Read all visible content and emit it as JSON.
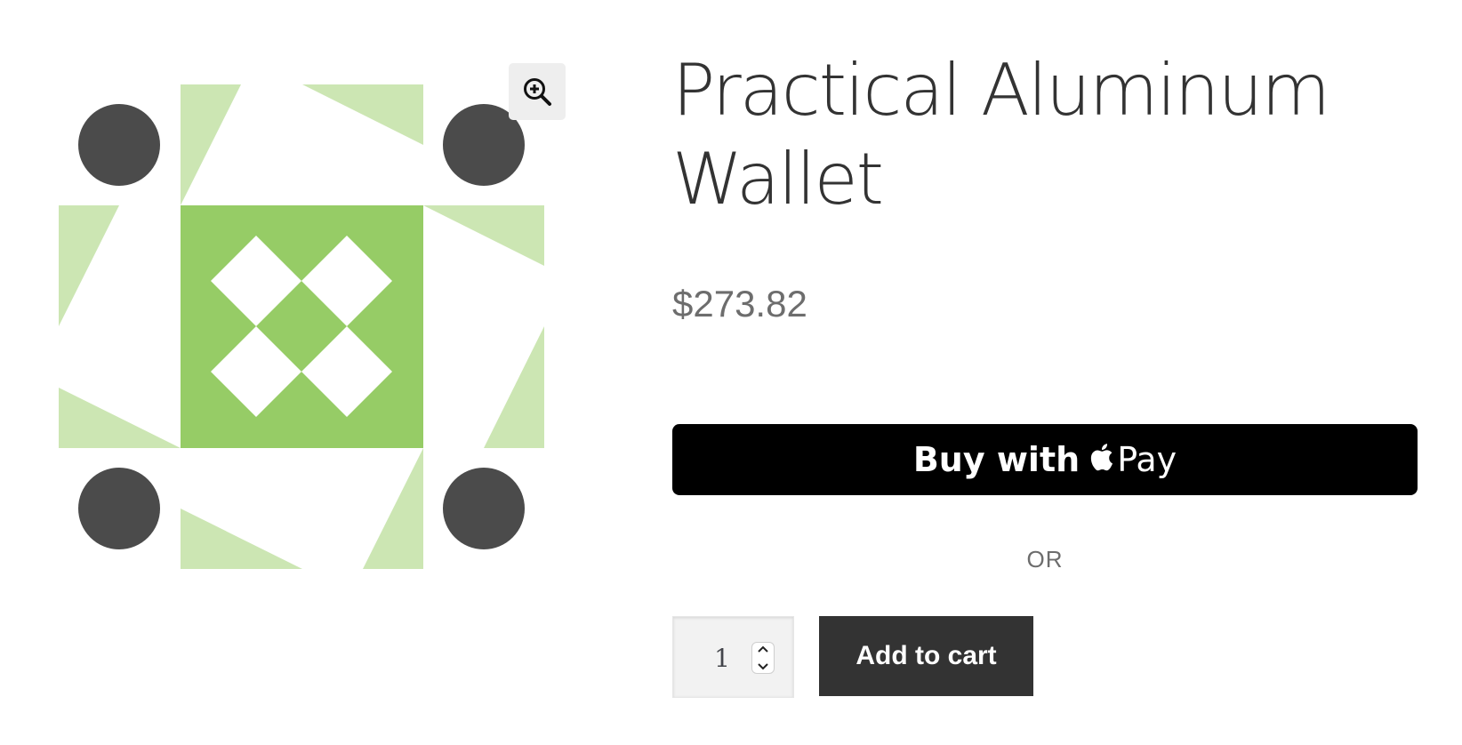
{
  "product": {
    "title": "Practical Aluminum Wallet",
    "price": "$273.82"
  },
  "gallery": {
    "zoom_icon": "zoom-in-icon",
    "colors": {
      "light_green": "#cce6b3",
      "green": "#96cc66",
      "dark_circle": "#4b4b4b",
      "white": "#ffffff"
    }
  },
  "payment": {
    "applepay_prefix": "Buy with",
    "applepay_brand": "Pay",
    "apple_icon": "apple-logo-icon",
    "or_label": "OR"
  },
  "cart": {
    "quantity": "1",
    "add_to_cart_label": "Add to cart"
  },
  "colors": {
    "title": "#333333",
    "price": "#6d6d6d",
    "applepay_bg": "#000000",
    "add_to_cart_bg": "#333333"
  }
}
